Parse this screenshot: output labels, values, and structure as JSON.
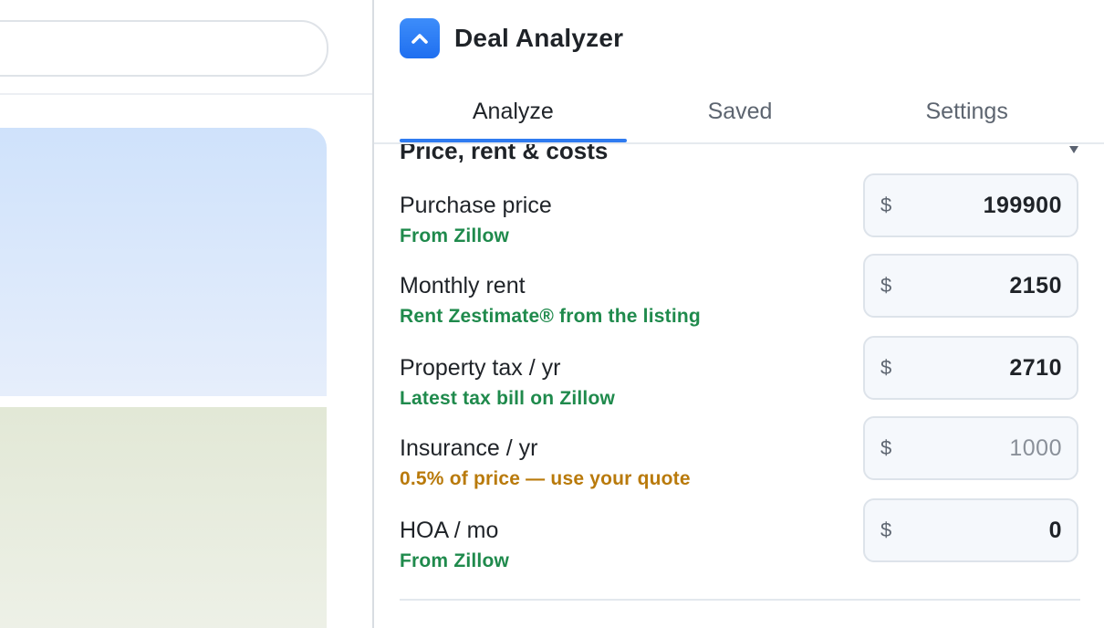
{
  "app": {
    "title": "Deal Analyzer",
    "accent_color": "#2f7bf0",
    "logo_icon": "chevron-up-icon"
  },
  "tabs": [
    {
      "label": "Analyze",
      "active": true
    },
    {
      "label": "Saved",
      "active": false
    },
    {
      "label": "Settings",
      "active": false
    }
  ],
  "section": {
    "title": "Price, rent & costs",
    "toggle_icon": "caret-down-icon"
  },
  "fields": [
    {
      "label": "Purchase price",
      "source": "From Zillow",
      "source_status": "ok",
      "currency": "$",
      "value": "199900",
      "placeholder": ""
    },
    {
      "label": "Monthly rent",
      "source": "Rent Zestimate® from the listing",
      "source_status": "ok",
      "currency": "$",
      "value": "2150",
      "placeholder": ""
    },
    {
      "label": "Property tax / yr",
      "source": "Latest tax bill on Zillow",
      "source_status": "ok",
      "currency": "$",
      "value": "2710",
      "placeholder": ""
    },
    {
      "label": "Insurance / yr",
      "source": "0.5% of price — use your quote",
      "source_status": "warning",
      "currency": "$",
      "value": "",
      "placeholder": "1000"
    },
    {
      "label": "HOA / mo",
      "source": "From Zillow",
      "source_status": "ok",
      "currency": "$",
      "value": "0",
      "placeholder": ""
    }
  ],
  "colors": {
    "source_ok": "#1f8a4c",
    "source_warning": "#b97a0b"
  }
}
